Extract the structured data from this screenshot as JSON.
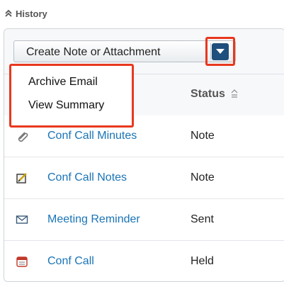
{
  "subpanel": {
    "title": "History",
    "collapse_icon": "double-chevron-up-icon"
  },
  "toolbar": {
    "action_label": "Create Note or Attachment",
    "caret_icon": "caret-down-icon"
  },
  "dropdown": {
    "items": [
      {
        "label": "Archive Email"
      },
      {
        "label": "View Summary"
      }
    ]
  },
  "table": {
    "columns": {
      "status": "Status"
    },
    "rows": [
      {
        "icon": "paperclip-icon",
        "subject": "Conf Call Minutes",
        "status": "Note"
      },
      {
        "icon": "note-edit-icon",
        "subject": "Conf Call Notes",
        "status": "Note"
      },
      {
        "icon": "envelope-icon",
        "subject": "Meeting Reminder",
        "status": "Sent"
      },
      {
        "icon": "calendar-call-icon",
        "subject": "Conf Call",
        "status": "Held"
      }
    ]
  },
  "colors": {
    "highlight": "#e8381e",
    "link": "#1a74b6",
    "caret_bg": "#1f4f7c"
  }
}
